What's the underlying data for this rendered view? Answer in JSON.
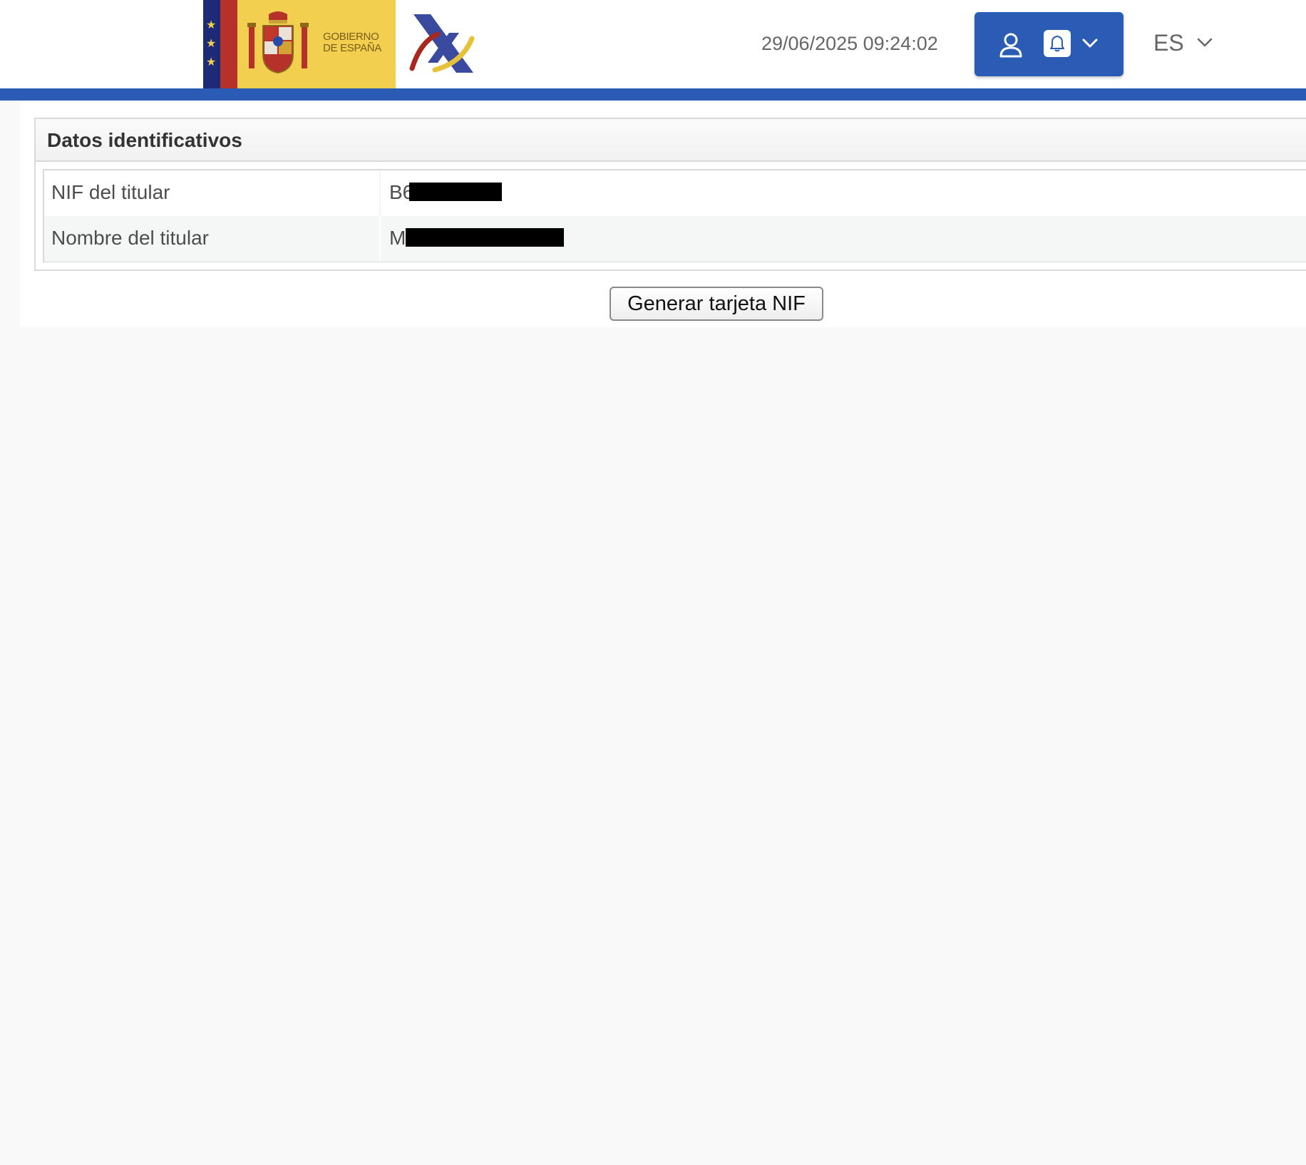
{
  "header": {
    "gov_logo_text_line1": "GOBIERNO",
    "gov_logo_text_line2": "DE ESPAÑA",
    "datetime": "29/06/2025 09:24:02",
    "language": "ES",
    "colors": {
      "primary_blue": "#2a5bb5",
      "gov_yellow": "#f2cf4f",
      "gov_red": "#b5312a",
      "gov_blue": "#1d2a76"
    },
    "icons": [
      "user-icon",
      "bell-icon",
      "chevron-down-icon"
    ]
  },
  "section": {
    "title": "Datos identificativos",
    "rows": [
      {
        "label": "NIF del titular",
        "value_visible": "B6",
        "redacted": true
      },
      {
        "label": "Nombre del titular",
        "value_visible": "M",
        "redacted": true
      }
    ]
  },
  "actions": {
    "generate_button_label": "Generar tarjeta NIF"
  }
}
